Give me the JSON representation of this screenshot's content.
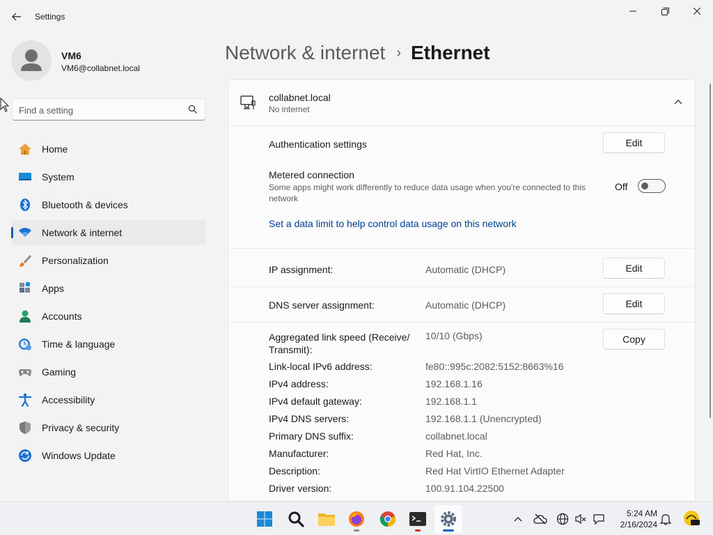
{
  "window": {
    "app_title": "Settings"
  },
  "profile": {
    "name": "VM6",
    "email": "VM6@collabnet.local"
  },
  "search": {
    "placeholder": "Find a setting"
  },
  "nav": {
    "items": [
      {
        "label": "Home",
        "icon": "home-icon"
      },
      {
        "label": "System",
        "icon": "system-icon"
      },
      {
        "label": "Bluetooth & devices",
        "icon": "bluetooth-icon"
      },
      {
        "label": "Network & internet",
        "icon": "wifi-icon",
        "active": true
      },
      {
        "label": "Personalization",
        "icon": "brush-icon"
      },
      {
        "label": "Apps",
        "icon": "apps-icon"
      },
      {
        "label": "Accounts",
        "icon": "accounts-icon"
      },
      {
        "label": "Time & language",
        "icon": "time-language-icon"
      },
      {
        "label": "Gaming",
        "icon": "gamepad-icon"
      },
      {
        "label": "Accessibility",
        "icon": "accessibility-icon"
      },
      {
        "label": "Privacy & security",
        "icon": "shield-icon"
      },
      {
        "label": "Windows Update",
        "icon": "update-icon"
      }
    ]
  },
  "header": {
    "parent": "Network & internet",
    "separator": "›",
    "current": "Ethernet"
  },
  "network": {
    "name": "collabnet.local",
    "status": "No internet"
  },
  "settings": {
    "auth_label": "Authentication settings",
    "auth_button": "Edit",
    "metered_label": "Metered connection",
    "metered_desc": "Some apps might work differently to reduce data usage when you're connected to this network",
    "metered_state": "Off",
    "data_limit_link": "Set a data limit to help control data usage on this network",
    "ip_label": "IP assignment:",
    "ip_value": "Automatic (DHCP)",
    "ip_button": "Edit",
    "dns_label": "DNS server assignment:",
    "dns_value": "Automatic (DHCP)",
    "dns_button": "Edit",
    "copy_button": "Copy"
  },
  "properties": [
    {
      "label": "Aggregated link speed (Receive/\nTransmit):",
      "value": "10/10 (Gbps)"
    },
    {
      "label": "Link-local IPv6 address:",
      "value": "fe80::995c:2082:5152:8663%16"
    },
    {
      "label": "IPv4 address:",
      "value": "192.168.1.16"
    },
    {
      "label": "IPv4 default gateway:",
      "value": "192.168.1.1"
    },
    {
      "label": "IPv4 DNS servers:",
      "value": "192.168.1.1 (Unencrypted)"
    },
    {
      "label": "Primary DNS suffix:",
      "value": "collabnet.local"
    },
    {
      "label": "Manufacturer:",
      "value": "Red Hat, Inc."
    },
    {
      "label": "Description:",
      "value": "Red Hat VirtIO Ethernet Adapter"
    },
    {
      "label": "Driver version:",
      "value": "100.91.104.22500"
    }
  ],
  "taskbar": {
    "apps": [
      "start-icon",
      "search-icon",
      "file-explorer-icon",
      "firefox-icon",
      "chrome-icon",
      "terminal-icon",
      "settings-icon"
    ],
    "clock_time": "5:24 AM",
    "clock_date": "2/16/2024"
  },
  "colors": {
    "accent": "#005fb8",
    "link": "#003e92",
    "background": "#f3f3f3"
  }
}
